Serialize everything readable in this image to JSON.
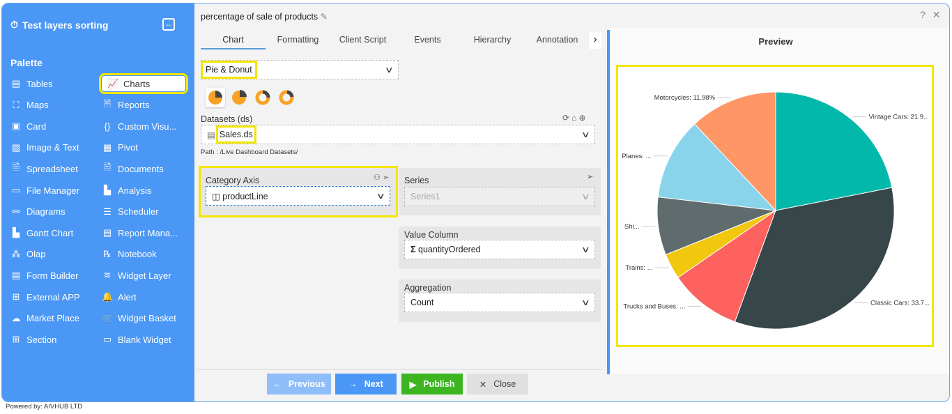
{
  "sidebar": {
    "app_title": "Test layers sorting",
    "palette_label": "Palette",
    "items": [
      {
        "label": "Tables",
        "icon": "table-icon",
        "glyph": "▤"
      },
      {
        "label": "Charts",
        "icon": "chart-icon",
        "glyph": "📈",
        "active": true
      },
      {
        "label": "Maps",
        "icon": "map-icon",
        "glyph": "⛶"
      },
      {
        "label": "Reports",
        "icon": "report-icon",
        "glyph": "🗎"
      },
      {
        "label": "Card",
        "icon": "card-icon",
        "glyph": "▣"
      },
      {
        "label": "Custom Visu...",
        "icon": "braces-icon",
        "glyph": "{}"
      },
      {
        "label": "Image & Text",
        "icon": "image-icon",
        "glyph": "▨"
      },
      {
        "label": "Pivot",
        "icon": "pivot-icon",
        "glyph": "▦"
      },
      {
        "label": "Spreadsheet",
        "icon": "spreadsheet-icon",
        "glyph": "🗎"
      },
      {
        "label": "Documents",
        "icon": "document-icon",
        "glyph": "🗎"
      },
      {
        "label": "File Manager",
        "icon": "file-manager-icon",
        "glyph": "▭"
      },
      {
        "label": "Analysis",
        "icon": "analysis-icon",
        "glyph": "▙"
      },
      {
        "label": "Diagrams",
        "icon": "diagram-icon",
        "glyph": "⚯"
      },
      {
        "label": "Scheduler",
        "icon": "scheduler-icon",
        "glyph": "☰"
      },
      {
        "label": "Gantt Chart",
        "icon": "gantt-icon",
        "glyph": "▙"
      },
      {
        "label": "Report Mana...",
        "icon": "clipboard-icon",
        "glyph": "▤"
      },
      {
        "label": "Olap",
        "icon": "olap-icon",
        "glyph": "⁂"
      },
      {
        "label": "Notebook",
        "icon": "rx-icon",
        "glyph": "℞"
      },
      {
        "label": "Form Builder",
        "icon": "form-icon",
        "glyph": "▤"
      },
      {
        "label": "Widget Layer",
        "icon": "layers-icon",
        "glyph": "≋"
      },
      {
        "label": "External APP",
        "icon": "apps-icon",
        "glyph": "⊞"
      },
      {
        "label": "Alert",
        "icon": "bell-icon",
        "glyph": "🔔"
      },
      {
        "label": "Market Place",
        "icon": "cloud-upload-icon",
        "glyph": "☁"
      },
      {
        "label": "Widget Basket",
        "icon": "basket-icon",
        "glyph": "🛒"
      },
      {
        "label": "Section",
        "icon": "section-icon",
        "glyph": "⊞"
      },
      {
        "label": "Blank Widget",
        "icon": "blank-widget-icon",
        "glyph": "▭"
      }
    ]
  },
  "footer": {
    "powered_by": "Powered by: AIVHUB LTD"
  },
  "editor": {
    "title": "percentage of sale of products",
    "tabs": [
      "Chart",
      "Formatting",
      "Client Script",
      "Events",
      "Hierarchy",
      "Annotation"
    ],
    "active_tab": "Chart",
    "chart_type": "Pie & Donut",
    "datasets_label": "Datasets (ds)",
    "dataset_value": "Sales.ds",
    "path": "Path : /Live Dashboard Datasets/",
    "category_axis_label": "Category Axis",
    "category_axis_value": "productLine",
    "series_label": "Series",
    "series_placeholder": "Series1",
    "value_column_label": "Value Column",
    "value_column_value": "quantityOrdered",
    "aggregation_label": "Aggregation",
    "aggregation_value": "Count",
    "buttons": {
      "previous": "Previous",
      "next": "Next",
      "publish": "Publish",
      "close": "Close"
    }
  },
  "preview": {
    "title": "Preview"
  },
  "window": {
    "help": "?",
    "close": "✕"
  },
  "colors": {
    "sidebar": "#4a97f5",
    "highlight": "#f3e600",
    "publish": "#3cb521",
    "next": "#4a97f5"
  },
  "chart_data": {
    "type": "pie",
    "categories": [
      "Vintage Cars",
      "Classic Cars",
      "Trucks and Buses",
      "Trains",
      "Ships",
      "Planes",
      "Motorcycles"
    ],
    "values": [
      21.9,
      33.7,
      9.82,
      3.5,
      7.9,
      11.2,
      11.98
    ],
    "unit": "%",
    "labels": [
      "Vintage Cars: 21.9...",
      "Classic Cars: 33.7...",
      "Trucks and Buses: ...",
      "Trains: ...",
      "Shi...",
      "Planes: ...",
      "Motorcycles: 11.98%"
    ],
    "colors": [
      "#01b8aa",
      "#374649",
      "#fd625e",
      "#f2c80f",
      "#5f6b6d",
      "#8ad4eb",
      "#fe9666"
    ]
  }
}
